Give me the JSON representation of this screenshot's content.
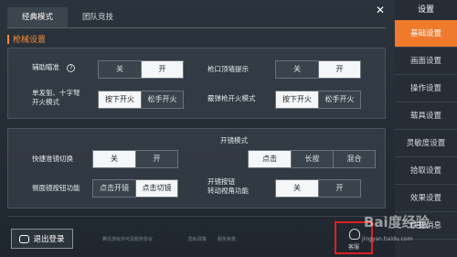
{
  "tabs": [
    "经典模式",
    "团队竞技"
  ],
  "section_title": "枪械设置",
  "panel1": {
    "aim_assist": {
      "label": "辅助瞄准",
      "options": [
        "关",
        "开"
      ],
      "selected": 1
    },
    "muzzle_wall": {
      "label": "枪口顶墙提示",
      "options": [
        "关",
        "开"
      ],
      "selected": 1
    },
    "single_shot": {
      "label_line1": "单发狙、十字弩",
      "label_line2": "开火模式",
      "options": [
        "按下开火",
        "松手开火"
      ],
      "selected": 0
    },
    "bolt_sniper": {
      "label": "霰弹枪开火模式",
      "options": [
        "按下开火",
        "松手开火"
      ],
      "selected": 0
    }
  },
  "panel2": {
    "quick_scope": {
      "label": "快捷准镜切换",
      "options": [
        "关",
        "开"
      ],
      "selected": 0
    },
    "scope_mode": {
      "label": "开镜模式",
      "options": [
        "点击",
        "长按",
        "混合"
      ],
      "selected": 0
    },
    "side_scope": {
      "label": "侧面镜按钮功能",
      "options": [
        "点击开镜",
        "点击切镜"
      ],
      "selected": 1
    },
    "scope_turn": {
      "label_line1": "开镜按钮",
      "label_line2": "转动视角功能",
      "options": [
        "关",
        "开"
      ],
      "selected": 0
    }
  },
  "sidebar": {
    "title": "设置",
    "close": "✕",
    "items": [
      "基础设置",
      "画面设置",
      "操作设置",
      "载具设置",
      "灵敏度设置",
      "拾取设置",
      "效果设置",
      "快捷消息"
    ],
    "active": 0
  },
  "bottom": {
    "logout": "退出登录",
    "link1": "腾讯游戏许可及服务协议",
    "link2": "隐私政策",
    "link3": "服务条款",
    "kefu": "客服"
  },
  "watermark": {
    "brand": "Bai度经验",
    "url": "jingyan.baidu.com"
  }
}
